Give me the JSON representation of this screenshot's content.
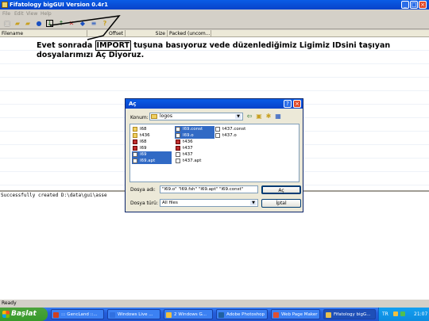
{
  "window": {
    "title": "Fifatology bigGUI Version 0.4r1",
    "menu": [
      "File",
      "Edit",
      "View",
      "Help"
    ],
    "columns": [
      "Filename",
      "Offset",
      "Size",
      "Packed (uncom..."
    ],
    "log_text": "Successfully created D:\\data\\gui\\asse",
    "status": "Ready"
  },
  "annotation": {
    "before": "Evet sonrada ",
    "highlight": "IMPORT",
    "after": " tuşuna basıyoruz vede düzenlediğimiz Ligimiz IDsini taşıyan dosyalarımızı Aç Diyoruz."
  },
  "dialog": {
    "title": "Aç",
    "konum_label": "Konum:",
    "konum_value": "logos",
    "files_col1": [
      {
        "name": "l68",
        "icon": "folder"
      },
      {
        "name": "t436",
        "icon": "folder"
      },
      {
        "name": "l68",
        "icon": "generic"
      },
      {
        "name": "l69",
        "icon": "generic"
      },
      {
        "name": "l69",
        "icon": "doc",
        "selected": true
      },
      {
        "name": "l69.apt",
        "icon": "doc",
        "selected": true
      }
    ],
    "files_col2": [
      {
        "name": "l69.const",
        "icon": "doc",
        "selected": true
      },
      {
        "name": "l69.o",
        "icon": "doc",
        "selected": true
      },
      {
        "name": "t436",
        "icon": "generic"
      },
      {
        "name": "t437",
        "icon": "generic"
      },
      {
        "name": "t437",
        "icon": "doc"
      },
      {
        "name": "t437.apt",
        "icon": "doc"
      }
    ],
    "files_col3": [
      {
        "name": "t437.const",
        "icon": "doc"
      },
      {
        "name": "t437.o",
        "icon": "doc"
      }
    ],
    "filename_label": "Dosya adı:",
    "filename_value": "\"l69.o\" \"l69.fsh\" \"l69.apt\" \"l69.const\"",
    "filetype_label": "Dosya türü:",
    "filetype_value": "All files",
    "open_button": "Aç",
    "cancel_button": "İptal"
  },
  "taskbar": {
    "start": "Başlat",
    "tasks": [
      {
        "label": "::: GencLand ::...",
        "icon_color": "#d04020"
      },
      {
        "label": "Windows Live ...",
        "icon_color": "#3070e0"
      },
      {
        "label": "2 Windows G...",
        "icon_color": "#f0c040"
      },
      {
        "label": "Adobe Photoshop",
        "icon_color": "#2060a0"
      },
      {
        "label": "Web Page Maker",
        "icon_color": "#e05030"
      },
      {
        "label": "Fifatology bigG...",
        "icon_color": "#e8c050",
        "active": true
      }
    ],
    "lang": "TR",
    "clock": "21:07"
  }
}
